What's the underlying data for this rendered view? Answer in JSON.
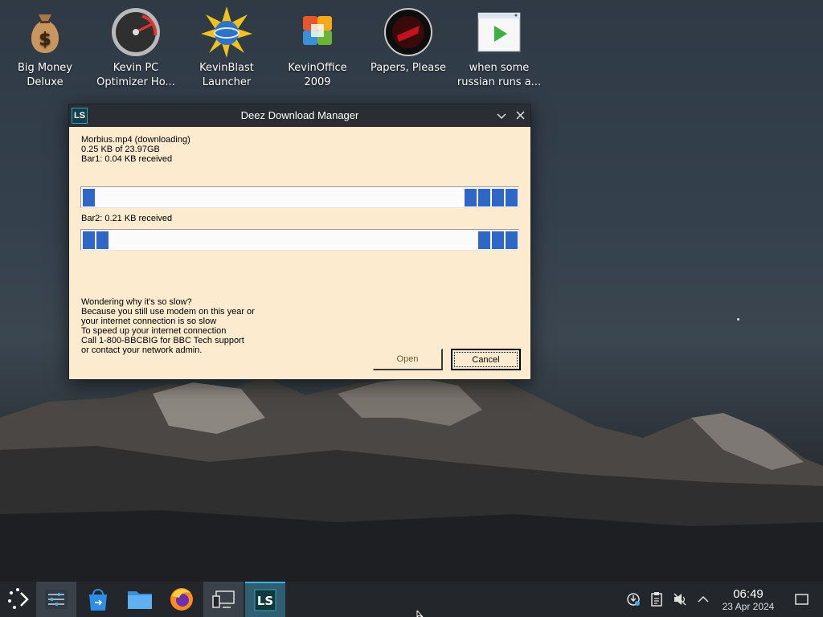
{
  "desktop": {
    "icons": [
      {
        "label": "Big Money Deluxe"
      },
      {
        "label": "Kevin PC Optimizer Ho..."
      },
      {
        "label": "KevinBlast Launcher"
      },
      {
        "label": "KevinOffice 2009"
      },
      {
        "label": "Papers, Please"
      },
      {
        "label": "when some russian runs a..."
      }
    ]
  },
  "window": {
    "title": "Deez Download Manager",
    "app_icon_text": "LS",
    "file_line": "Morbius.mp4 (downloading)",
    "size_line": "0.25 KB of 23.97GB",
    "bar1_label": "Bar1: 0.04 KB received",
    "bar2_label": "Bar2: 0.21 KB received",
    "message": [
      "Wondering why it's so slow?",
      "Because you still use modem on this year or",
      "your internet connection is so slow",
      "To speed up your internet connection",
      "Call 1-800-BBCBIG for BBC Tech support",
      "or contact your network admin."
    ],
    "open_label": "Open",
    "cancel_label": "Cancel"
  },
  "taskbar": {
    "clock_time": "06:49",
    "clock_date": "23 Apr 2024",
    "focused_app_text": "LS"
  },
  "colors": {
    "progress_block": "#2e67c8",
    "window_bg": "#fdebd0",
    "titlebar": "#2a2e32",
    "taskbar": "#23272b"
  }
}
